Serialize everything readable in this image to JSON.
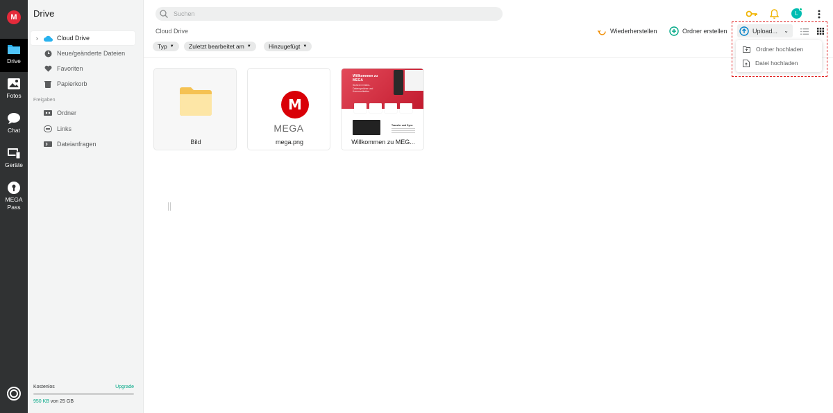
{
  "rail": {
    "logo": "M",
    "items": [
      {
        "label": "Drive"
      },
      {
        "label": "Fotos"
      },
      {
        "label": "Chat"
      },
      {
        "label": "Geräte"
      },
      {
        "label": "MEGA\nPass"
      }
    ]
  },
  "sidebar": {
    "title": "Drive",
    "items": [
      {
        "label": "Cloud Drive"
      },
      {
        "label": "Neue/geänderte Dateien"
      },
      {
        "label": "Favoriten"
      },
      {
        "label": "Papierkorb"
      }
    ],
    "section_label": "Freigaben",
    "shared_items": [
      {
        "label": "Ordner"
      },
      {
        "label": "Links"
      },
      {
        "label": "Dateianfragen"
      }
    ],
    "storage": {
      "plan": "Kostenlos",
      "upgrade": "Upgrade",
      "used": "950 KB",
      "of_total": " von 25 GB"
    }
  },
  "header": {
    "search_placeholder": "Suchen",
    "avatar_initial": "L"
  },
  "toolbar": {
    "breadcrumb": "Cloud Drive",
    "restore_label": "Wiederherstellen",
    "create_folder_label": "Ordner erstellen",
    "upload_label": "Upload...",
    "upload_menu": [
      {
        "label": "Ordner hochladen"
      },
      {
        "label": "Datei hochladen"
      }
    ]
  },
  "filters": [
    {
      "label": "Typ"
    },
    {
      "label": "Zuletzt bearbeitet am"
    },
    {
      "label": "Hinzugefügt"
    }
  ],
  "files": [
    {
      "name": "Bild"
    },
    {
      "name": "mega.png",
      "logo_letter": "M",
      "logo_word": "MEGA"
    },
    {
      "name": "Willkommen zu MEG...",
      "thumb_title": "Willkommen zu MEGA",
      "thumb_sub": "Sicherer Online-Datenspeicher und Kommunikation",
      "thumb_lower": "Transfer und Sync"
    }
  ],
  "colors": {
    "brand_red": "#d90007",
    "accent_green": "#00a886",
    "rail_bg": "#303233",
    "highlight": "#e01a1a"
  }
}
